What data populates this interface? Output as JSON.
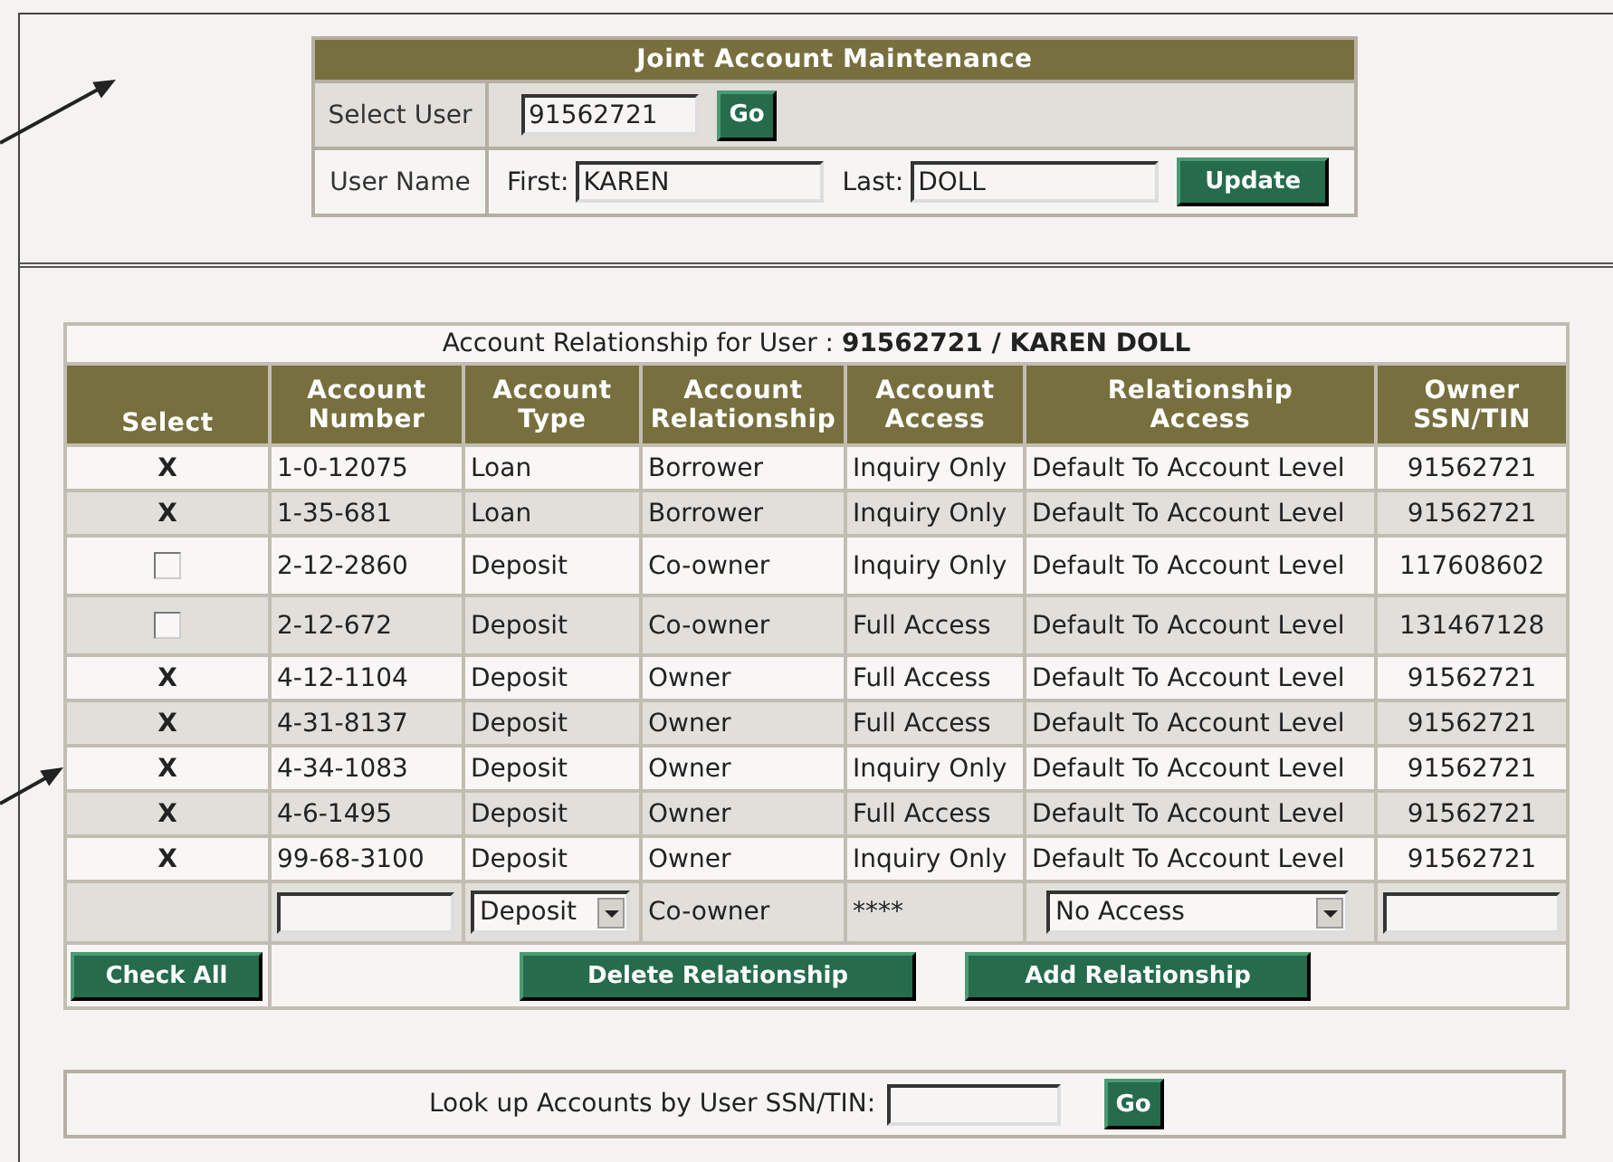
{
  "maintenance": {
    "title": "Joint Account Maintenance",
    "select_user_label": "Select User",
    "user_id": "91562721",
    "go_button": "Go",
    "user_name_label": "User Name",
    "first_label": "First:",
    "first_name": "KAREN",
    "last_label": "Last:",
    "last_name": "DOLL",
    "update_button": "Update"
  },
  "relationships": {
    "caption": "Account Relationship for User : **91562721 / KAREN DOLL**",
    "columns": [
      "Select",
      "Account Number",
      "Account Type",
      "Account Relationship",
      "Account Access",
      "Relationship Access",
      "Owner SSN/TIN"
    ],
    "rows": [
      {
        "kind": "linked",
        "select": "X",
        "account_number": "1-0-12075",
        "account_type": "Loan",
        "relationship": "Borrower",
        "access": "Inquiry Only",
        "relationship_access": "Default To Account Level",
        "owner": "91562721"
      },
      {
        "kind": "linked",
        "select": "X",
        "account_number": "1-35-681",
        "account_type": "Loan",
        "relationship": "Borrower",
        "access": "Inquiry Only",
        "relationship_access": "Default To Account Level",
        "owner": "91562721"
      },
      {
        "kind": "checkbox",
        "checked": false,
        "account_number": "2-12-2860",
        "account_type": "Deposit",
        "relationship": "Co-owner",
        "access": "Inquiry Only",
        "relationship_access": "Default To Account Level",
        "owner": "117608602"
      },
      {
        "kind": "checkbox",
        "checked": false,
        "account_number": "2-12-672",
        "account_type": "Deposit",
        "relationship": "Co-owner",
        "access": "Full Access",
        "relationship_access": "Default To Account Level",
        "owner": "131467128"
      },
      {
        "kind": "linked",
        "select": "X",
        "account_number": "4-12-1104",
        "account_type": "Deposit",
        "relationship": "Owner",
        "access": "Full Access",
        "relationship_access": "Default To Account Level",
        "owner": "91562721"
      },
      {
        "kind": "linked",
        "select": "X",
        "account_number": "4-31-8137",
        "account_type": "Deposit",
        "relationship": "Owner",
        "access": "Full Access",
        "relationship_access": "Default To Account Level",
        "owner": "91562721"
      },
      {
        "kind": "linked",
        "select": "X",
        "account_number": "4-34-1083",
        "account_type": "Deposit",
        "relationship": "Owner",
        "access": "Inquiry Only",
        "relationship_access": "Default To Account Level",
        "owner": "91562721"
      },
      {
        "kind": "linked",
        "select": "X",
        "account_number": "4-6-1495",
        "account_type": "Deposit",
        "relationship": "Owner",
        "access": "Full Access",
        "relationship_access": "Default To Account Level",
        "owner": "91562721"
      },
      {
        "kind": "linked",
        "select": "X",
        "account_number": "99-68-3100",
        "account_type": "Deposit",
        "relationship": "Owner",
        "access": "Inquiry Only",
        "relationship_access": "Default To Account Level",
        "owner": "91562721"
      }
    ],
    "new_row": {
      "account_type": "Deposit",
      "relationship": "Co-owner",
      "access": "****",
      "relationship_access": "No Access"
    },
    "buttons": {
      "check_all": "Check All",
      "delete": "Delete Relationship",
      "add": "Add Relationship"
    }
  },
  "lookup": {
    "label": "Look up Accounts by User SSN/TIN:",
    "go_button": "Go"
  }
}
